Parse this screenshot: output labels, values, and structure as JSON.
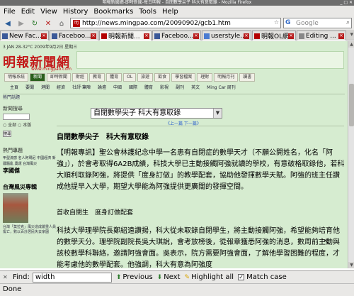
{
  "window": {
    "title": "明報新聞網-即時新聞-每日明報 - 自閉數學尖子 科大有意取錄 - Mozilla Firefox"
  },
  "menu": [
    "File",
    "Edit",
    "View",
    "History",
    "Bookmarks",
    "Tools",
    "Help"
  ],
  "nav": {
    "url": "http://news.mingpao.com/20090902/gcb1.htm",
    "search_placeholder": "Google"
  },
  "tabs": [
    {
      "label": "New Fac...",
      "active": false
    },
    {
      "label": "Faceboo...",
      "active": false
    },
    {
      "label": "明報新聞...",
      "active": true
    },
    {
      "label": "Faceboo...",
      "active": false
    },
    {
      "label": "userstyle...",
      "active": false
    },
    {
      "label": "明報OL網",
      "active": false
    },
    {
      "label": "Editing ...",
      "active": false
    }
  ],
  "page": {
    "date_line": "3 JAN 28-32°C 2009年9月2日 星期三",
    "logo_text": "明報新聞網",
    "logo_sub": "www.mingpao.com",
    "site_tabs": [
      "明報系統",
      "新聞",
      "即時新聞",
      "財經",
      "教育",
      "體育",
      "OL",
      "旅遊",
      "飲食",
      "學習檔案",
      "理財",
      "明報月刊",
      "讀書"
    ],
    "links": [
      "主頁",
      "要聞",
      "港聞",
      "經濟",
      "社評·筆陣",
      "論壇",
      "中國",
      "國際",
      "體育",
      "影視",
      "副刊",
      "英文",
      "Ming Car 周刊"
    ],
    "breadcrumb": "熱門話題",
    "left": {
      "search_title": "新聞搜尋",
      "search_opts": "○ 全部 ○ 本版",
      "search_btn": "搜尋",
      "hot_head": "熱門專題",
      "hot_grid": "甲型流感 名人阿瑪尼 中國經濟 新疆騷亂 奧運 台灣風災",
      "hot_name": "李國傑",
      "wind_title": "台灣風災專輯",
      "wind_text": "台灣「莫拉克」風災造成嚴重人員傷亡，數以百計居民失去家園"
    },
    "article": {
      "select_value": "自閉數學尖子 科大有意取錄",
      "pager": "《上一篇 下一篇》",
      "title": "自閉數學尖子　科大有意取錄",
      "lead": "【明報專訊】聖公會林護紀念中學一名患有自閉症的數學天才（不願公開姓名，化名「阿強」），於會考取得6A2B成績，科技大學已主動接觸阿強就讀的學校，有意破格取錄他，若科大順利取錄阿強，將提供「度身訂做」的教學配套，協助他發揮數學天賦。阿強的班主任讚成他提早入大學，期望大學能為阿強提供更廣闊的發揮空間。",
      "subhead": "首收自閉生　度身訂做配套",
      "body": "科技大學理學院長鄭紹遠讚揚，科大從未取錄自閉學生，將主動接觸阿強，希望能夠培育他的數學天分。理學院副院長吳大琪說，會考放榜後，從報章獲悉阿強的消息，數周前主動與該校數學科聯絡，邀請阿強會面。吳表示，院方需要阿強會面，了解他學習困難的程度，才能考慮他的數學配套。他強調，科大有意為阿強度"
    }
  },
  "findbar": {
    "label": "Find:",
    "query": "width",
    "previous": "Previous",
    "next": "Next",
    "highlight": "Highlight all",
    "match_case": "Match case"
  },
  "status": "Done",
  "colors": {
    "page_bg": "#d6ecd0",
    "logo_red": "#c31a1a"
  }
}
